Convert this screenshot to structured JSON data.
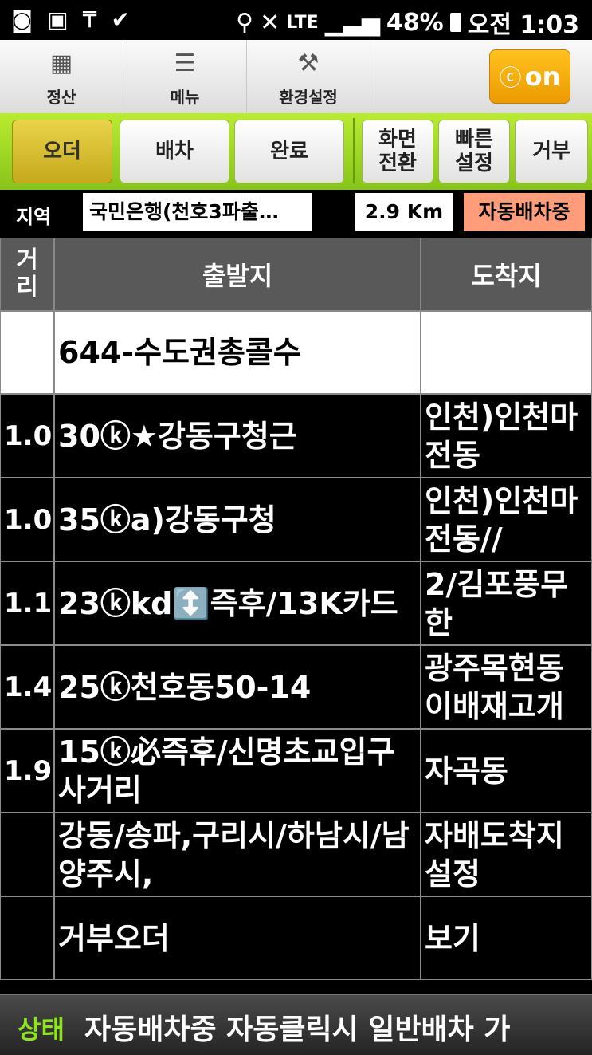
{
  "status_bar": {
    "left_icons": [
      "notification-icon",
      "image-icon",
      "t-icon",
      "check-icon"
    ],
    "network": "LTE",
    "battery": "48%",
    "clock": "오전 1:03"
  },
  "toolbar": {
    "items": [
      {
        "label": "정산",
        "icon": "calculator-icon"
      },
      {
        "label": "메뉴",
        "icon": "menu-list-icon"
      },
      {
        "label": "환경설정",
        "icon": "tools-icon"
      }
    ],
    "on_button": "on"
  },
  "tabs": [
    {
      "label": "오더",
      "active": true
    },
    {
      "label": "배차",
      "active": false
    },
    {
      "label": "완료",
      "active": false
    },
    {
      "label": "화면\n전환",
      "active": false
    },
    {
      "label": "빠른\n설정",
      "active": false
    },
    {
      "label": "거부",
      "active": false
    }
  ],
  "region": {
    "label": "지역",
    "value": "국민은행(천호3파출…",
    "distance": "2.9 Km",
    "auto_status": "자동배차중"
  },
  "table": {
    "headers": {
      "dist": "거리",
      "from": "출발지",
      "to": "도착지"
    },
    "rows": [
      {
        "dist": "",
        "from": "644-수도권총콜수",
        "to": ""
      },
      {
        "dist": "1.0",
        "from": "30ⓚ★강동구청근",
        "to": "인천)인천마전동"
      },
      {
        "dist": "1.0",
        "from": "35ⓚa)강동구청",
        "to": "인천)인천마전동//"
      },
      {
        "dist": "1.1",
        "from": "23ⓚkd↕️즉후/13K카드",
        "to": "2/김포풍무한"
      },
      {
        "dist": "1.4",
        "from": "25ⓚ천호동50-14",
        "to": "광주목현동이배재고개"
      },
      {
        "dist": "1.9",
        "from": "15ⓚ必즉후/신명초교입구사거리",
        "to": "자곡동"
      },
      {
        "dist": "",
        "from": "강동/송파,구리시/하남시/남양주시,",
        "to": "자배도착지설정"
      },
      {
        "dist": "",
        "from": "거부오더",
        "to": "보기"
      }
    ]
  },
  "footer": {
    "label": "상태",
    "text": "자동배차중 자동클릭시 일반배차 가"
  }
}
